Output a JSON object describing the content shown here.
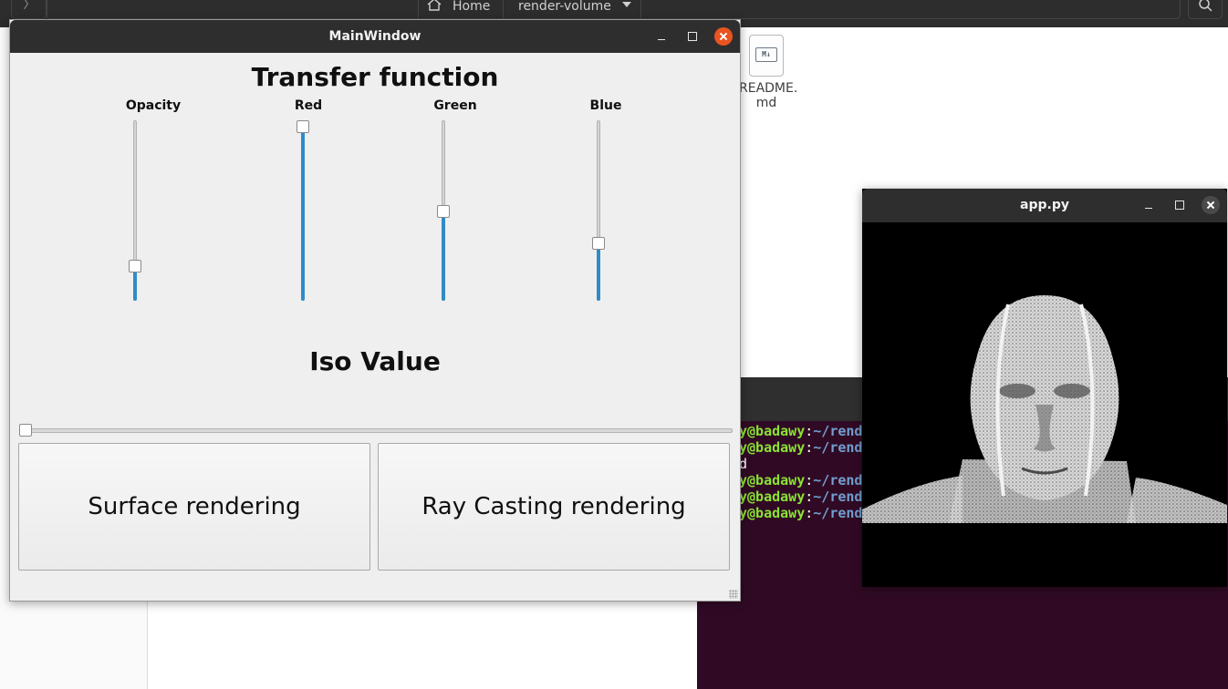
{
  "file_manager": {
    "back_icon": "chevron-left-icon",
    "breadcrumbs": [
      {
        "label": "Home",
        "icon": "home-icon"
      },
      {
        "label": "render-volume"
      }
    ],
    "file": {
      "name": "README.\nmd",
      "icon": "markdown-file-icon",
      "badge": "M↓"
    },
    "search_icon": "search-icon"
  },
  "main_window": {
    "title": "MainWindow",
    "heading_transfer": "Transfer function",
    "sliders": [
      {
        "label": "Opacity",
        "value": 0.18
      },
      {
        "label": "Red",
        "value": 1.0
      },
      {
        "label": "Green",
        "value": 0.5
      },
      {
        "label": "Blue",
        "value": 0.31
      }
    ],
    "heading_iso": "Iso Value",
    "iso_value": 0.0,
    "buttons": {
      "surface": "Surface rendering",
      "ray": "Ray Casting rendering"
    },
    "accent_color": "#308cc6"
  },
  "app_window": {
    "title": "app.py",
    "content": "3D rendered head volume"
  },
  "terminal": {
    "lines": [
      {
        "user": "y@badawy",
        "sep": ":",
        "path": "~/rend"
      },
      {
        "user": "y@badawy",
        "sep": ":",
        "path": "~/rend"
      },
      {
        "plain": "d"
      },
      {
        "user": "y@badawy",
        "sep": ":",
        "path": "~/rend"
      },
      {
        "user": "y@badawy",
        "sep": ":",
        "path": "~/rend"
      },
      {
        "user": "y@badawy",
        "sep": ":",
        "path": "~/rend"
      }
    ]
  },
  "colors": {
    "title_bar": "#2e2e2e",
    "close_button": "#e95420",
    "terminal_bg": "#300a24",
    "prompt_user": "#8ae234",
    "prompt_path": "#729fcf"
  }
}
